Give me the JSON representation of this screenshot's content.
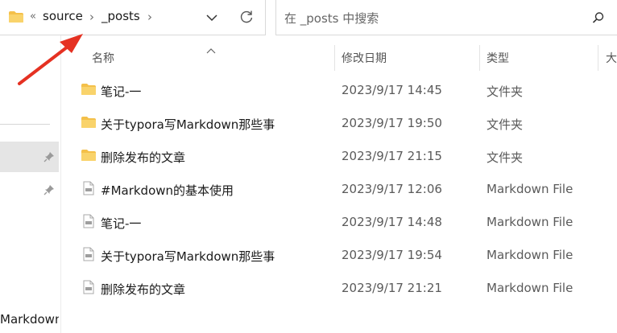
{
  "address_bar": {
    "overflow": "«",
    "crumbs": [
      "source",
      "_posts"
    ],
    "separator": "›"
  },
  "search": {
    "placeholder": "在 _posts 中搜索"
  },
  "nav": {
    "partial_item": "Markdown那"
  },
  "columns": {
    "name": "名称",
    "date": "修改日期",
    "type": "类型",
    "size": "大"
  },
  "files": [
    {
      "name": "笔记-一",
      "date": "2023/9/17 14:45",
      "type": "文件夹",
      "kind": "folder"
    },
    {
      "name": "关于typora写Markdown那些事",
      "date": "2023/9/17 19:50",
      "type": "文件夹",
      "kind": "folder"
    },
    {
      "name": "删除发布的文章",
      "date": "2023/9/17 21:15",
      "type": "文件夹",
      "kind": "folder"
    },
    {
      "name": "#Markdown的基本使用",
      "date": "2023/9/17 12:06",
      "type": "Markdown File",
      "kind": "markdown"
    },
    {
      "name": "笔记-一",
      "date": "2023/9/17 14:48",
      "type": "Markdown File",
      "kind": "markdown"
    },
    {
      "name": "关于typora写Markdown那些事",
      "date": "2023/9/17 19:54",
      "type": "Markdown File",
      "kind": "markdown"
    },
    {
      "name": "删除发布的文章",
      "date": "2023/9/17 21:21",
      "type": "Markdown File",
      "kind": "markdown"
    }
  ],
  "colors": {
    "folder": "#f4c04a",
    "annotation": "#e53122"
  }
}
